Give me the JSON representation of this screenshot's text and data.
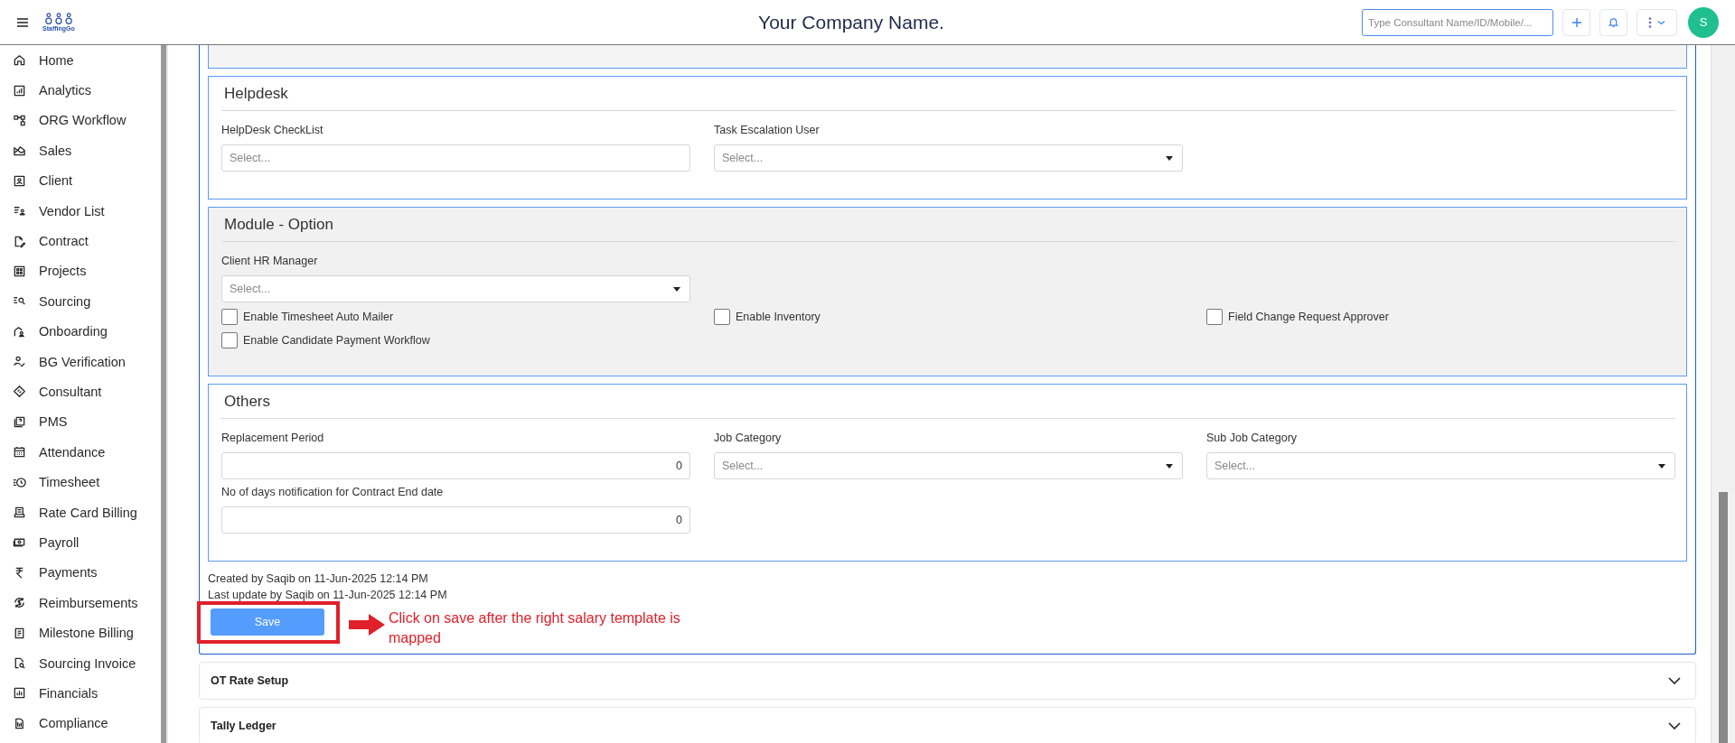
{
  "header": {
    "logo_text": "StaffingGo",
    "title": "Your Company Name.",
    "search": {
      "placeholder": "Type Consultant Name/ID/Mobile/..."
    },
    "avatar": "S"
  },
  "sidebar": {
    "items": [
      {
        "label": "Home"
      },
      {
        "label": "Analytics"
      },
      {
        "label": "ORG Workflow"
      },
      {
        "label": "Sales"
      },
      {
        "label": "Client"
      },
      {
        "label": "Vendor List"
      },
      {
        "label": "Contract"
      },
      {
        "label": "Projects"
      },
      {
        "label": "Sourcing"
      },
      {
        "label": "Onboarding"
      },
      {
        "label": "BG Verification"
      },
      {
        "label": "Consultant"
      },
      {
        "label": "PMS"
      },
      {
        "label": "Attendance"
      },
      {
        "label": "Timesheet"
      },
      {
        "label": "Rate Card Billing"
      },
      {
        "label": "Payroll"
      },
      {
        "label": "Payments"
      },
      {
        "label": "Reimbursements"
      },
      {
        "label": "Milestone Billing"
      },
      {
        "label": "Sourcing Invoice"
      },
      {
        "label": "Financials"
      },
      {
        "label": "Compliance"
      }
    ]
  },
  "sections": [
    {
      "title": "Helpdesk",
      "shaded": false,
      "fields": [
        {
          "kind": "picker",
          "label": "HelpDesk CheckList",
          "placeholder": "Select..."
        },
        {
          "kind": "dropdown",
          "label": "Task Escalation User",
          "placeholder": "Select..."
        }
      ]
    },
    {
      "title": "Module - Option",
      "shaded": true,
      "fields": [
        {
          "kind": "dropdown",
          "label": "Client HR Manager",
          "placeholder": "Select..."
        }
      ],
      "checkboxes": [
        {
          "label": "Enable Timesheet Auto Mailer",
          "checked": false
        },
        {
          "label": "Enable Inventory",
          "checked": false
        },
        {
          "label": "Field Change Request Approver",
          "checked": false
        },
        {
          "label": "Enable Candidate Payment Workflow",
          "checked": false
        }
      ]
    },
    {
      "title": "Others",
      "shaded": false,
      "fields": [
        {
          "kind": "number",
          "label": "Replacement Period",
          "value": "0"
        },
        {
          "kind": "dropdown",
          "label": "Job Category",
          "placeholder": "Select..."
        },
        {
          "kind": "dropdown",
          "label": "Sub Job Category",
          "placeholder": "Select..."
        },
        {
          "kind": "number",
          "label": "No of days notification for Contract End date",
          "value": "0"
        }
      ]
    }
  ],
  "audit": [
    "Created by Saqib on 11-Jun-2025 12:14 PM",
    "Last update by Saqib on 11-Jun-2025 12:14 PM"
  ],
  "save_button": "Save",
  "annotation": "Click on save after the right salary template is mapped",
  "accordions": [
    {
      "title": "OT Rate Setup",
      "expanded": false
    },
    {
      "title": "Tally Ledger",
      "expanded": false
    }
  ]
}
